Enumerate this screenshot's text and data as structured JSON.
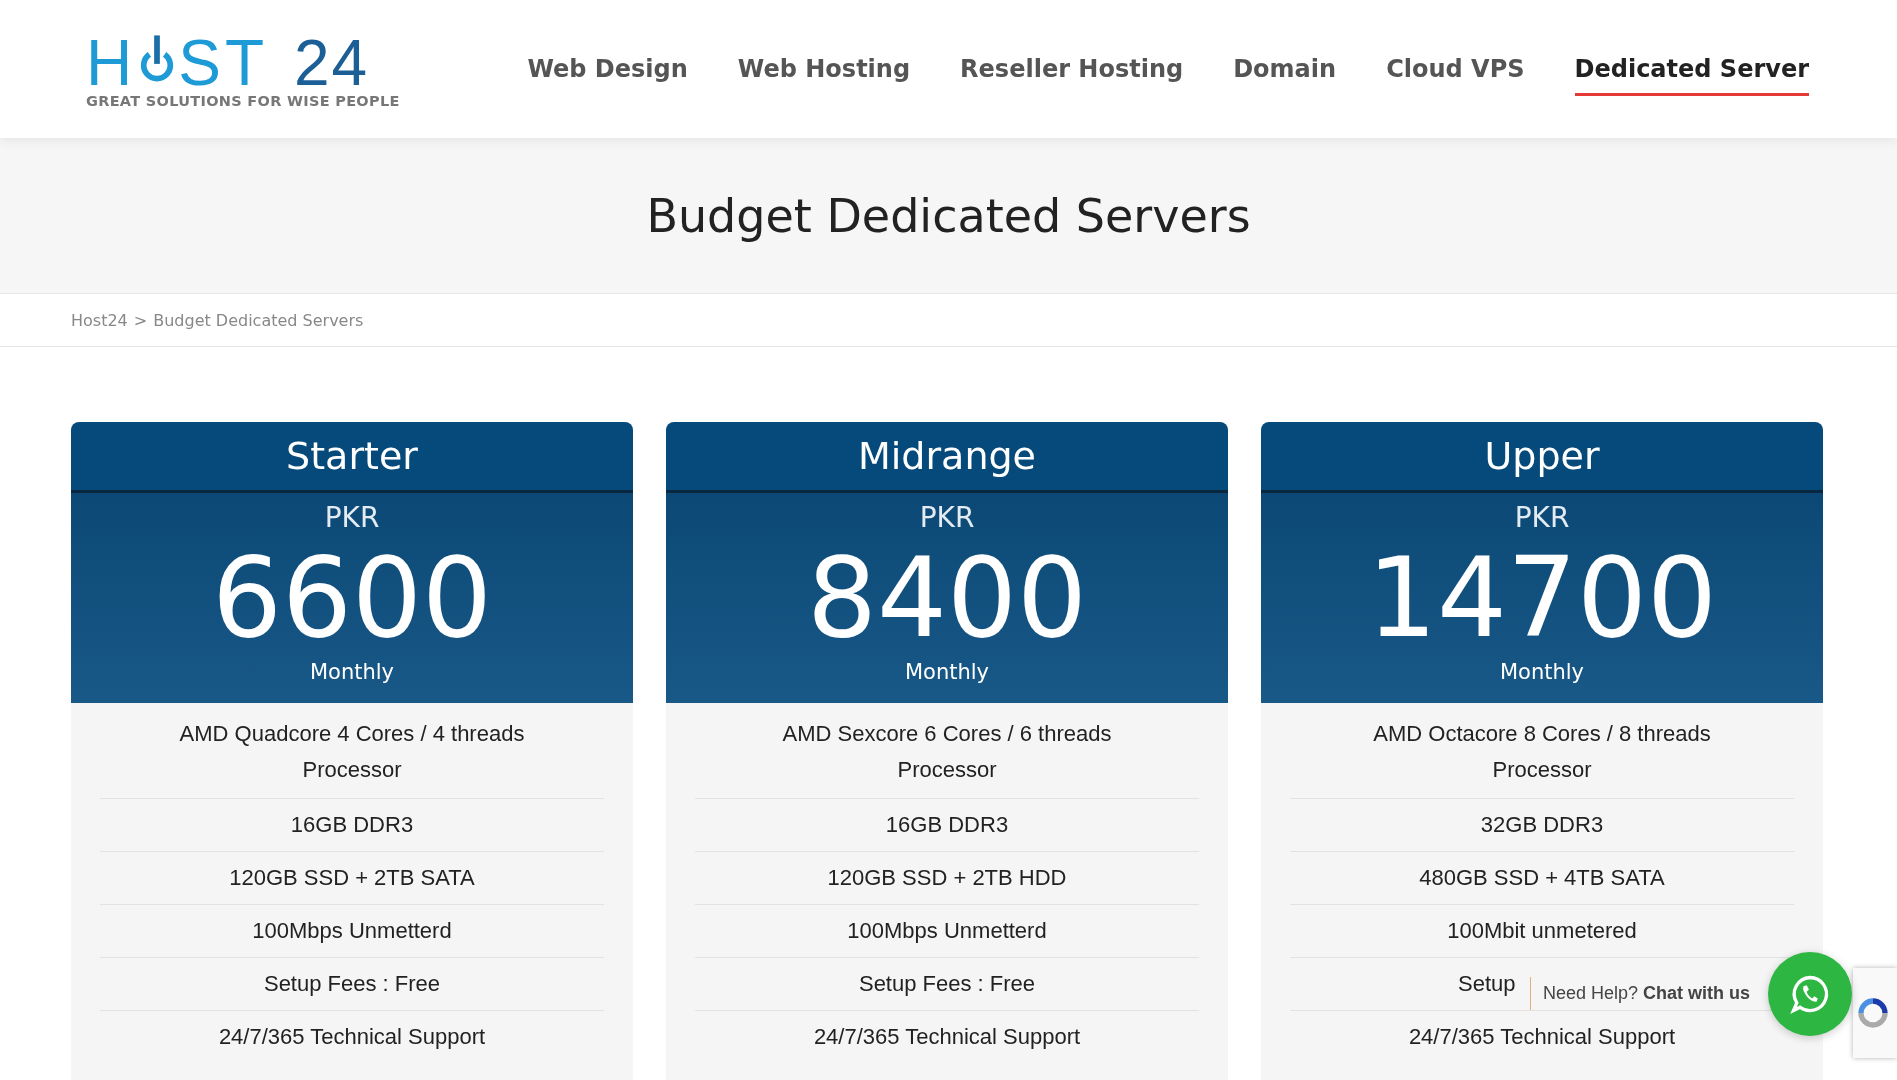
{
  "logo": {
    "name_start": "H",
    "name_end": "ST",
    "number": "24",
    "tagline": "GREAT SOLUTIONS FOR WISE PEOPLE"
  },
  "nav": [
    {
      "label": "Web Design",
      "selected": false
    },
    {
      "label": "Web Hosting",
      "selected": false
    },
    {
      "label": "Reseller Hosting",
      "selected": false
    },
    {
      "label": "Domain",
      "selected": false
    },
    {
      "label": "Cloud VPS",
      "selected": false
    },
    {
      "label": "Dedicated Server",
      "selected": true
    }
  ],
  "page_title": "Budget Dedicated Servers",
  "breadcrumb": [
    {
      "label": "Host24"
    },
    {
      "label": "Budget Dedicated Servers"
    }
  ],
  "breadcrumb_separator": ">",
  "plans": [
    {
      "name": "Starter",
      "currency": "PKR",
      "price": "6600",
      "period": "Monthly",
      "features": [
        "AMD Quadcore 4 Cores / 4 threads Processor",
        "16GB DDR3",
        "120GB SSD + 2TB SATA",
        "100Mbps Unmetterd",
        "Setup Fees : Free",
        "24/7/365 Technical Support"
      ]
    },
    {
      "name": "Midrange",
      "currency": "PKR",
      "price": "8400",
      "period": "Monthly",
      "features": [
        "AMD Sexcore 6 Cores / 6 threads Processor",
        "16GB DDR3",
        "120GB SSD + 2TB HDD",
        "100Mbps Unmetterd",
        "Setup Fees : Free",
        "24/7/365 Technical Support"
      ]
    },
    {
      "name": "Upper",
      "currency": "PKR",
      "price": "14700",
      "period": "Monthly",
      "features": [
        "AMD Octacore 8 Cores / 8 threads Processor",
        "32GB DDR3",
        "480GB SSD + 4TB SATA",
        "100Mbit unmetered",
        "Setup",
        "24/7/365 Technical Support"
      ]
    }
  ],
  "chat": {
    "text": "Need Help? **Chat with us**"
  }
}
